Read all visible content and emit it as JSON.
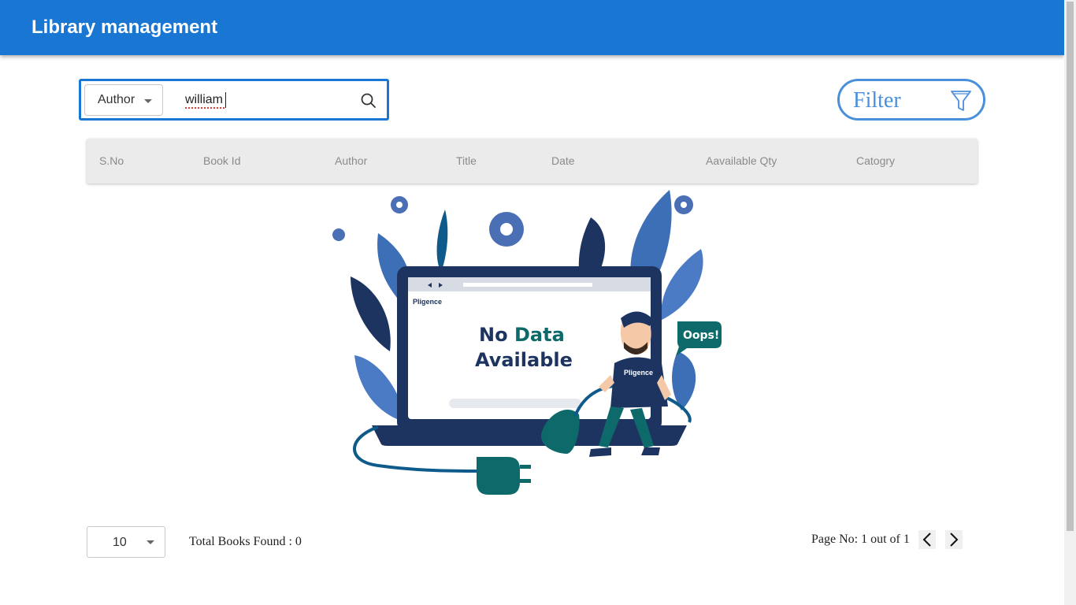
{
  "header": {
    "title": "Library management"
  },
  "search": {
    "field_selected": "Author",
    "query": "william"
  },
  "filter": {
    "label": "Filter"
  },
  "table": {
    "columns": [
      "S.No",
      "Book Id",
      "Author",
      "Title",
      "Date",
      "Aavailable Qty",
      "Catogry"
    ]
  },
  "empty_state": {
    "brand": "Pligence",
    "line1_a": "No",
    "line1_b": "Data",
    "line2": "Available",
    "bubble": "Oops!"
  },
  "pagination": {
    "page_size": "10",
    "total_books": "Total Books Found : 0",
    "page_info": "Page No: 1 out of 1"
  },
  "colors": {
    "primary": "#1976d2",
    "filter_accent": "#4a8fd9",
    "navy": "#1d3461",
    "teal": "#0e6a6a"
  },
  "icons": {
    "search": "search-icon",
    "filter": "filter-funnel-icon",
    "prev": "chevron-left-icon",
    "next": "chevron-right-icon"
  }
}
